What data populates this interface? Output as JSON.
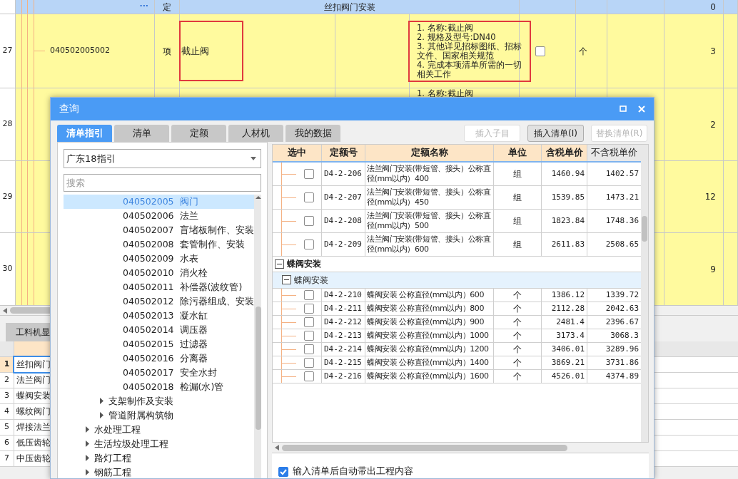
{
  "main_table": {
    "rows": [
      {
        "kind": "quota",
        "selected": true,
        "ellipsis": "···",
        "type": "定",
        "name": "丝扣阀门安装",
        "quantity": "0"
      },
      {
        "kind": "item",
        "selected": false,
        "row_number": "27",
        "code": "040502005002",
        "type": "项",
        "name": "截止阀",
        "name_highlighted": true,
        "description": [
          "1. 名称:截止阀",
          "2. 规格及型号:DN40",
          "3. 其他详见招标图纸、招标文件、国家相关规范",
          "4. 完成本项清单所需的一切相关工作"
        ],
        "description_highlighted": true,
        "checked": false,
        "unit": "个",
        "quantity": "3"
      },
      {
        "kind": "item",
        "selected": false,
        "row_number": "28",
        "description": [
          "1. 名称:截止阀"
        ],
        "quantity": "2"
      },
      {
        "kind": "item",
        "selected": false,
        "row_number": "29",
        "quantity": "12"
      },
      {
        "kind": "item",
        "selected": false,
        "row_number": "30",
        "quantity": "9"
      }
    ]
  },
  "bottom_panel": {
    "tab": "工料机显",
    "rows": [
      {
        "number": "1",
        "name": "丝扣阀门",
        "selected": true
      },
      {
        "number": "2",
        "name": "法兰阀门",
        "selected": false
      },
      {
        "number": "3",
        "name": "蝶阀安装",
        "selected": false
      },
      {
        "number": "4",
        "name": "螺纹阀门",
        "selected": false
      },
      {
        "number": "5",
        "name": "焊接法兰",
        "selected": false
      },
      {
        "number": "6",
        "name": "低压齿轮",
        "selected": false
      },
      {
        "number": "7",
        "name": "中压齿轮",
        "selected": false
      }
    ]
  },
  "dialog": {
    "title": "查询",
    "tabs": [
      {
        "label": "清单指引",
        "selected": true
      },
      {
        "label": "清单",
        "selected": false
      },
      {
        "label": "定额",
        "selected": false
      },
      {
        "label": "人材机",
        "selected": false
      },
      {
        "label": "我的数据",
        "selected": false
      }
    ],
    "buttons": [
      {
        "label": "插入子目",
        "disabled": true
      },
      {
        "label": "插入清单(I)",
        "disabled": false
      },
      {
        "label": "替换清单(R)",
        "disabled": true
      }
    ],
    "guide_select": {
      "value": "广东18指引"
    },
    "search": {
      "placeholder": "搜索"
    },
    "tree": [
      {
        "children": [
          {
            "children": [
              {
                "code": "040502005",
                "label": "阀门",
                "selected": true
              },
              {
                "code": "040502006",
                "label": "法兰",
                "selected": false
              },
              {
                "code": "040502007",
                "label": "盲堵板制作、安装",
                "selected": false
              },
              {
                "code": "040502008",
                "label": "套管制作、安装",
                "selected": false
              },
              {
                "code": "040502009",
                "label": "水表",
                "selected": false
              },
              {
                "code": "040502010",
                "label": "消火栓",
                "selected": false
              },
              {
                "code": "040502011",
                "label": "补偿器(波纹管)",
                "selected": false
              },
              {
                "code": "040502012",
                "label": "除污器组成、安装",
                "selected": false
              },
              {
                "code": "040502013",
                "label": "凝水缸",
                "selected": false
              },
              {
                "code": "040502014",
                "label": "调压器",
                "selected": false
              },
              {
                "code": "040502015",
                "label": "过滤器",
                "selected": false
              },
              {
                "code": "040502016",
                "label": "分离器",
                "selected": false
              },
              {
                "code": "040502017",
                "label": "安全水封",
                "selected": false
              },
              {
                "code": "040502018",
                "label": "检漏(水)管",
                "selected": false
              }
            ]
          },
          {
            "label": "支架制作及安装",
            "expanded": false,
            "selected": false
          },
          {
            "label": "管道附属构筑物",
            "expanded": false,
            "selected": false
          }
        ]
      },
      {
        "label": "水处理工程",
        "expanded": false,
        "selected": false
      },
      {
        "label": "生活垃圾处理工程",
        "expanded": false,
        "selected": false
      },
      {
        "label": "路灯工程",
        "expanded": false,
        "selected": false
      },
      {
        "label": "钢筋工程",
        "expanded": false,
        "selected": false
      }
    ],
    "grid": {
      "columns": [
        {
          "label": "选中",
          "highlighted": true
        },
        {
          "label": "定额号",
          "highlighted": true
        },
        {
          "label": "定额名称",
          "highlighted": true
        },
        {
          "label": "单位",
          "highlighted": true
        },
        {
          "label": "含税单价",
          "highlighted": true
        },
        {
          "label": "不含税单价",
          "highlighted": false
        }
      ],
      "rows": [
        {
          "kind": "item",
          "checked": false,
          "code": "D4-2-206",
          "name": "法兰阀门安装(带短管、接头）公称直径(mm以内）400",
          "unit": "组",
          "price_with_tax": "1460.94",
          "price_without_tax": "1402.57"
        },
        {
          "kind": "item",
          "checked": false,
          "code": "D4-2-207",
          "name": "法兰阀门安装(带短管、接头）公称直径(mm以内）450",
          "unit": "组",
          "price_with_tax": "1539.85",
          "price_without_tax": "1473.21"
        },
        {
          "kind": "item",
          "checked": false,
          "code": "D4-2-208",
          "name": "法兰阀门安装(带短管、接头）公称直径(mm以内）500",
          "unit": "组",
          "price_with_tax": "1823.84",
          "price_without_tax": "1748.36"
        },
        {
          "kind": "item",
          "checked": false,
          "code": "D4-2-209",
          "name": "法兰阀门安装(带短管、接头）公称直径(mm以内）600",
          "unit": "组",
          "price_with_tax": "2611.83",
          "price_without_tax": "2508.65"
        },
        {
          "kind": "group",
          "label": "蝶阀安装",
          "expanded": true
        },
        {
          "kind": "subgroup",
          "label": "蝶阀安装",
          "expanded": true
        },
        {
          "kind": "item",
          "checked": false,
          "code": "D4-2-210",
          "name": "蝶阀安装 公称直径(mm以内）600",
          "unit": "个",
          "price_with_tax": "1386.12",
          "price_without_tax": "1339.72"
        },
        {
          "kind": "item",
          "checked": false,
          "code": "D4-2-211",
          "name": "蝶阀安装 公称直径(mm以内）800",
          "unit": "个",
          "price_with_tax": "2112.28",
          "price_without_tax": "2042.63"
        },
        {
          "kind": "item",
          "checked": false,
          "code": "D4-2-212",
          "name": "蝶阀安装 公称直径(mm以内）900",
          "unit": "个",
          "price_with_tax": "2481.4",
          "price_without_tax": "2396.67"
        },
        {
          "kind": "item",
          "checked": false,
          "code": "D4-2-213",
          "name": "蝶阀安装 公称直径(mm以内）1000",
          "unit": "个",
          "price_with_tax": "3173.4",
          "price_without_tax": "3068.3"
        },
        {
          "kind": "item",
          "checked": false,
          "code": "D4-2-214",
          "name": "蝶阀安装 公称直径(mm以内）1200",
          "unit": "个",
          "price_with_tax": "3406.01",
          "price_without_tax": "3289.96"
        },
        {
          "kind": "item",
          "checked": false,
          "code": "D4-2-215",
          "name": "蝶阀安装 公称直径(mm以内）1400",
          "unit": "个",
          "price_with_tax": "3869.21",
          "price_without_tax": "3731.86"
        },
        {
          "kind": "item",
          "checked": false,
          "code": "D4-2-216",
          "name": "蝶阀安装 公称直径(mm以内）1600",
          "unit": "个",
          "price_with_tax": "4526.01",
          "price_without_tax": "4374.89"
        }
      ]
    },
    "auto_fill": {
      "label": "输入清单后自动带出工程内容",
      "checked": true
    }
  }
}
